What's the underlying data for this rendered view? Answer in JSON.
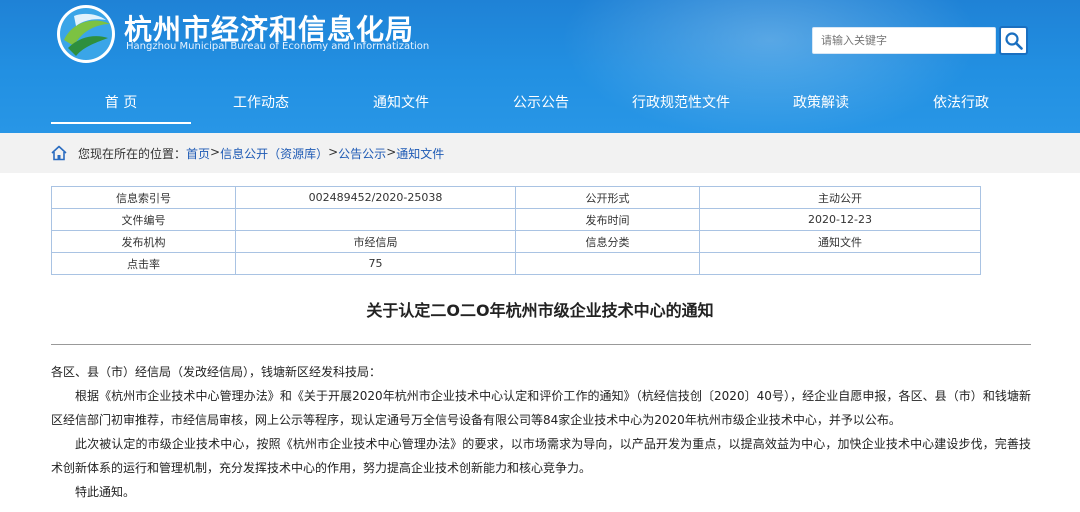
{
  "header": {
    "title": "杭州市经济和信息化局",
    "subtitle": "Hangzhou Municipal Bureau of Economy and Informatization",
    "search_placeholder": "请输入关键字"
  },
  "nav": {
    "items": [
      "首 页",
      "工作动态",
      "通知文件",
      "公示公告",
      "行政规范性文件",
      "政策解读",
      "依法行政"
    ],
    "active_index": 0
  },
  "breadcrumb": {
    "prefix": "您现在所在的位置：",
    "links": [
      "首页",
      "信息公开（资源库）",
      "公告公示",
      "通知文件"
    ],
    "separators": [
      "> ",
      " > ",
      "> "
    ]
  },
  "info_table": {
    "rows": [
      [
        "信息索引号",
        "002489452/2020-25038",
        "公开形式",
        "主动公开"
      ],
      [
        "文件编号",
        "",
        "发布时间",
        "2020-12-23"
      ],
      [
        "发布机构",
        "市经信局",
        "信息分类",
        "通知文件"
      ],
      [
        "点击率",
        "75",
        "",
        ""
      ]
    ]
  },
  "document": {
    "title": "关于认定二O二O年杭州市级企业技术中心的通知",
    "salutation": "各区、县（市）经信局（发改经信局），钱塘新区经发科技局：",
    "paragraphs": [
      "根据《杭州市企业技术中心管理办法》和《关于开展2020年杭州市企业技术中心认定和评价工作的通知》（杭经信技创〔2020〕40号），经企业自愿申报，各区、县（市）和钱塘新区经信部门初审推荐，市经信局审核，网上公示等程序，现认定通号万全信号设备有限公司等84家企业技术中心为2020年杭州市级企业技术中心，并予以公布。",
      "此次被认定的市级企业技术中心，按照《杭州市企业技术中心管理办法》的要求，以市场需求为导向，以产品开发为重点，以提高效益为中心，加快企业技术中心建设步伐，完善技术创新体系的运行和管理机制，充分发挥技术中心的作用，努力提高企业技术创新能力和核心竞争力。",
      "特此通知。"
    ]
  },
  "colors": {
    "header_blue": "#2290e2",
    "link_blue": "#1f5bb5",
    "table_border": "#a9c3e3"
  }
}
